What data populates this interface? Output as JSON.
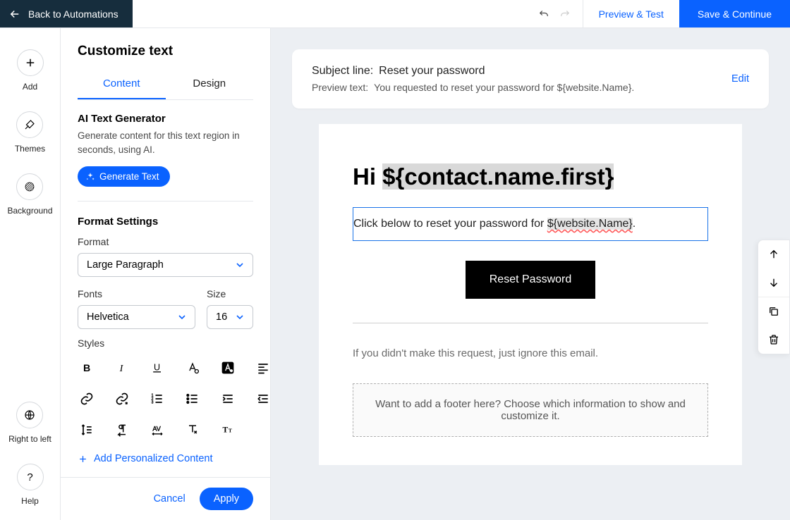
{
  "topbar": {
    "back": "Back to Automations",
    "preview": "Preview & Test",
    "save": "Save & Continue"
  },
  "rail": {
    "add": "Add",
    "themes": "Themes",
    "background": "Background",
    "rtl": "Right to left",
    "help": "Help"
  },
  "panel": {
    "title": "Customize text",
    "tabs": {
      "content": "Content",
      "design": "Design"
    },
    "ai": {
      "heading": "AI Text Generator",
      "sub": "Generate content for this text region in seconds, using AI.",
      "button": "Generate Text"
    },
    "format": {
      "heading": "Format Settings",
      "format_label": "Format",
      "format_value": "Large Paragraph",
      "fonts_label": "Fonts",
      "fonts_value": "Helvetica",
      "size_label": "Size",
      "size_value": "16",
      "styles_label": "Styles"
    },
    "add_personalized": "Add Personalized Content",
    "cancel": "Cancel",
    "apply": "Apply"
  },
  "subject": {
    "line_label": "Subject line:",
    "line_value": "Reset your password",
    "preview_label": "Preview text:",
    "preview_value": "You requested to reset your password for ${website.Name}.",
    "edit": "Edit"
  },
  "email": {
    "greeting_prefix": "Hi ",
    "greeting_var": "${contact.name.first}",
    "body_prefix": "Click below to reset your password for ",
    "body_var": "${website.Name}",
    "body_suffix": ".",
    "reset_button": "Reset Password",
    "ignore": "If you didn't make this request, just ignore this email.",
    "footer_placeholder": "Want to add a footer here? Choose which information to show and customize it."
  }
}
